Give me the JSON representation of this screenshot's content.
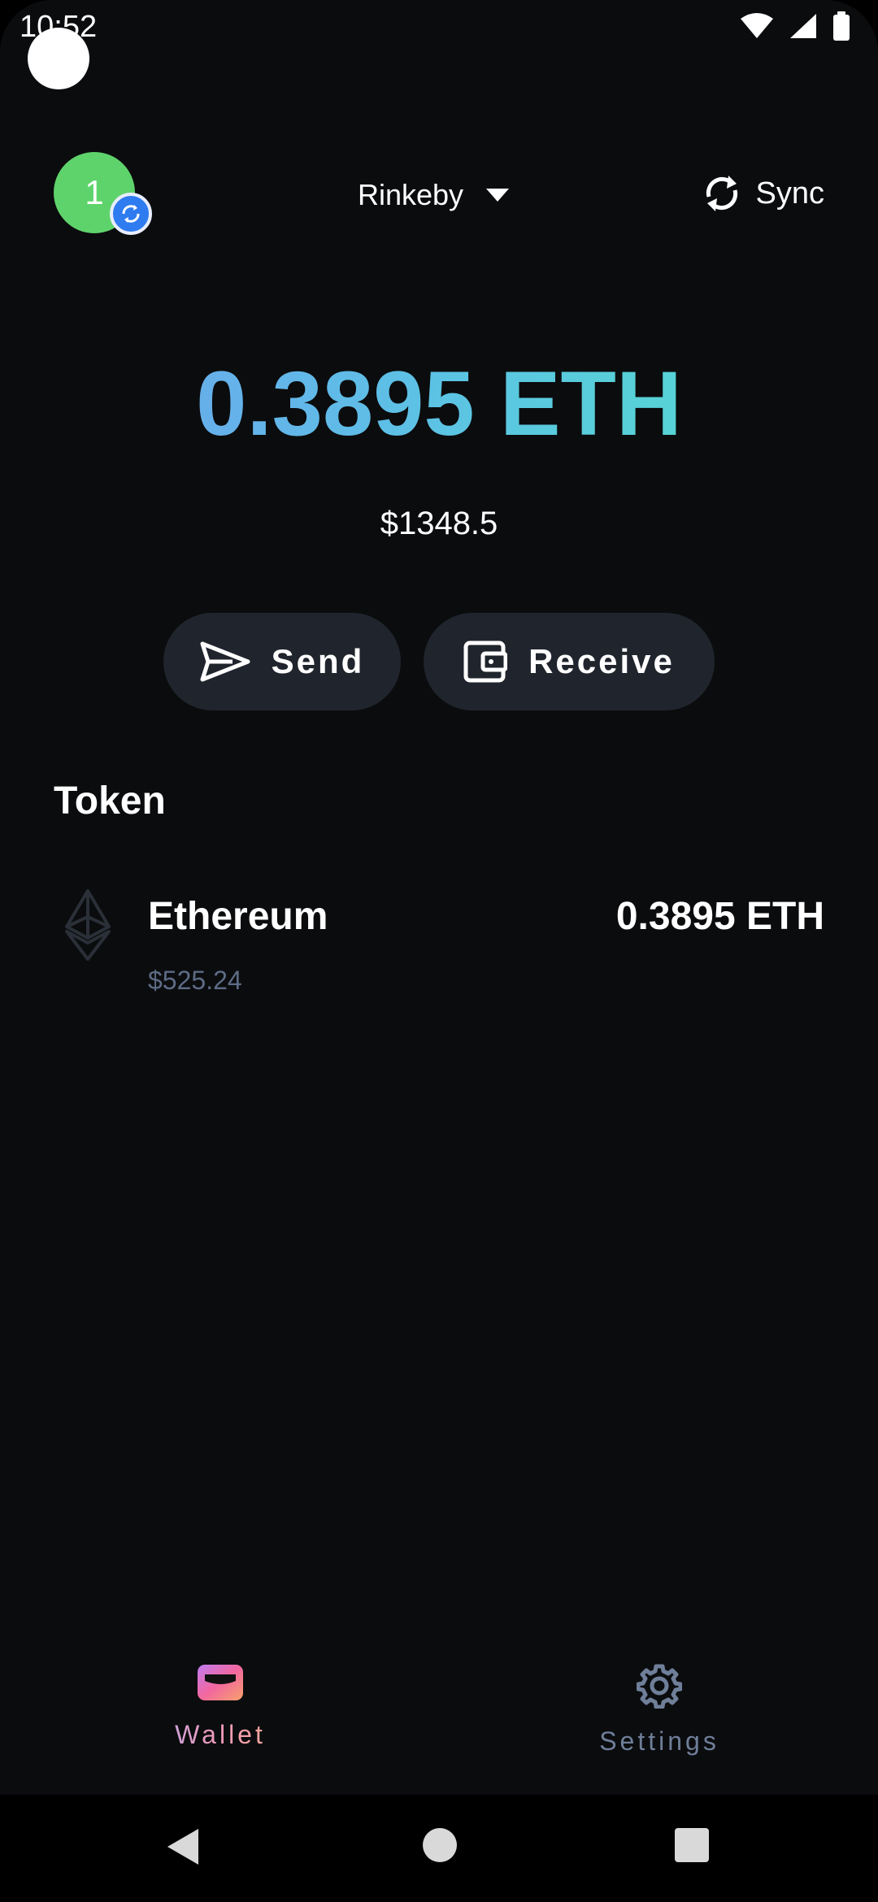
{
  "status_bar": {
    "time": "10:52",
    "icons": [
      "wifi-icon",
      "signal-icon",
      "battery-icon"
    ]
  },
  "header": {
    "avatar_text": "1",
    "network_label": "Rinkeby",
    "sync_label": "Sync"
  },
  "balance": {
    "eth": "0.3895 ETH",
    "usd": "$1348.5"
  },
  "actions": {
    "send_label": "Send",
    "receive_label": "Receive"
  },
  "tokens": {
    "section_title": "Token",
    "items": [
      {
        "name": "Ethereum",
        "usd_value": "$525.24",
        "amount": "0.3895 ETH",
        "icon": "ethereum-icon"
      }
    ]
  },
  "bottom_nav": {
    "items": [
      {
        "label": "Wallet",
        "icon": "wallet-icon",
        "active": true
      },
      {
        "label": "Settings",
        "icon": "gear-icon",
        "active": false
      }
    ]
  },
  "colors": {
    "background": "#0b0c0e",
    "button_bg": "#20252d",
    "avatar_green": "#5fd36b",
    "accent_blue": "#6f9ff0",
    "accent_teal": "#53e0c9",
    "muted_text": "#5d6b85"
  }
}
